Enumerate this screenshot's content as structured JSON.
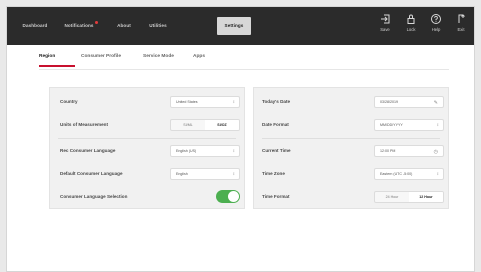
{
  "topnav": {
    "tabs": [
      {
        "label": "Dashboard"
      },
      {
        "label": "Notifications"
      },
      {
        "label": "About"
      },
      {
        "label": "Utilities"
      },
      {
        "label": "Settings"
      }
    ],
    "active": "Settings",
    "tools": [
      {
        "label": "Save",
        "icon": "save-icon"
      },
      {
        "label": "Lock",
        "icon": "lock-icon"
      },
      {
        "label": "Help",
        "icon": "help-icon"
      },
      {
        "label": "Exit",
        "icon": "exit-icon"
      }
    ]
  },
  "subtabs": {
    "items": [
      {
        "label": "Region"
      },
      {
        "label": "Consumer Profile"
      },
      {
        "label": "Service Mode"
      },
      {
        "label": "Apps"
      }
    ],
    "active": "Region"
  },
  "left_panel": {
    "country": {
      "label": "Country",
      "value": "United States"
    },
    "units": {
      "label": "Units of Measurement",
      "options": [
        "SI/ML",
        "SI/OZ"
      ],
      "selected": "SI/OZ"
    },
    "rec_language": {
      "label": "Rec Consumer Language",
      "value": "English (US)"
    },
    "default_language": {
      "label": "Default Consumer Language",
      "value": "English"
    },
    "language_selection": {
      "label": "Consumer Language Selection",
      "enabled": true
    }
  },
  "right_panel": {
    "todays_date": {
      "label": "Today's Date",
      "value": "03/28/2019"
    },
    "date_format": {
      "label": "Date Format",
      "value": "MM/DD/YYYY"
    },
    "current_time": {
      "label": "Current Time",
      "value": "12:00 PM"
    },
    "time_zone": {
      "label": "Time Zone",
      "value": "Eastern (UTC -5:00)"
    },
    "time_format": {
      "label": "Time Format",
      "options": [
        "24 Hour",
        "12 Hour"
      ],
      "selected": "12 Hour"
    }
  },
  "colors": {
    "topbar": "#2b2b2b",
    "accent": "#c8102e",
    "toggle_on": "#4caf50"
  }
}
